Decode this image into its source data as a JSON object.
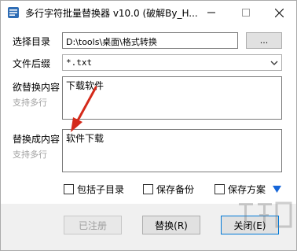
{
  "window": {
    "title": "多行字符批量替换器 v10.0 (破解By_H...",
    "controls": [
      "minimize",
      "maximize",
      "close"
    ]
  },
  "form": {
    "directory_label": "选择目录",
    "directory_value": "D:\\tools\\桌面\\格式转换",
    "browse_label": "...",
    "suffix_label": "文件后缀",
    "suffix_value": "*.txt",
    "find_label": "欲替换内容",
    "find_sub_label": "支持多行",
    "find_value": "下载软件",
    "replace_label": "替换成内容",
    "replace_sub_label": "支持多行",
    "replace_value": "软件下载"
  },
  "options": {
    "include_subdirs": "包括子目录",
    "save_backup": "保存备份",
    "save_scheme": "保存方案",
    "include_subdirs_checked": false,
    "save_backup_checked": false,
    "save_scheme_checked": false
  },
  "buttons": {
    "registered": "已注册",
    "replace": "替换(R)",
    "close": "关闭(E)"
  },
  "colors": {
    "annotation_arrow": "#d42a1a",
    "accent": "#0078d7"
  }
}
